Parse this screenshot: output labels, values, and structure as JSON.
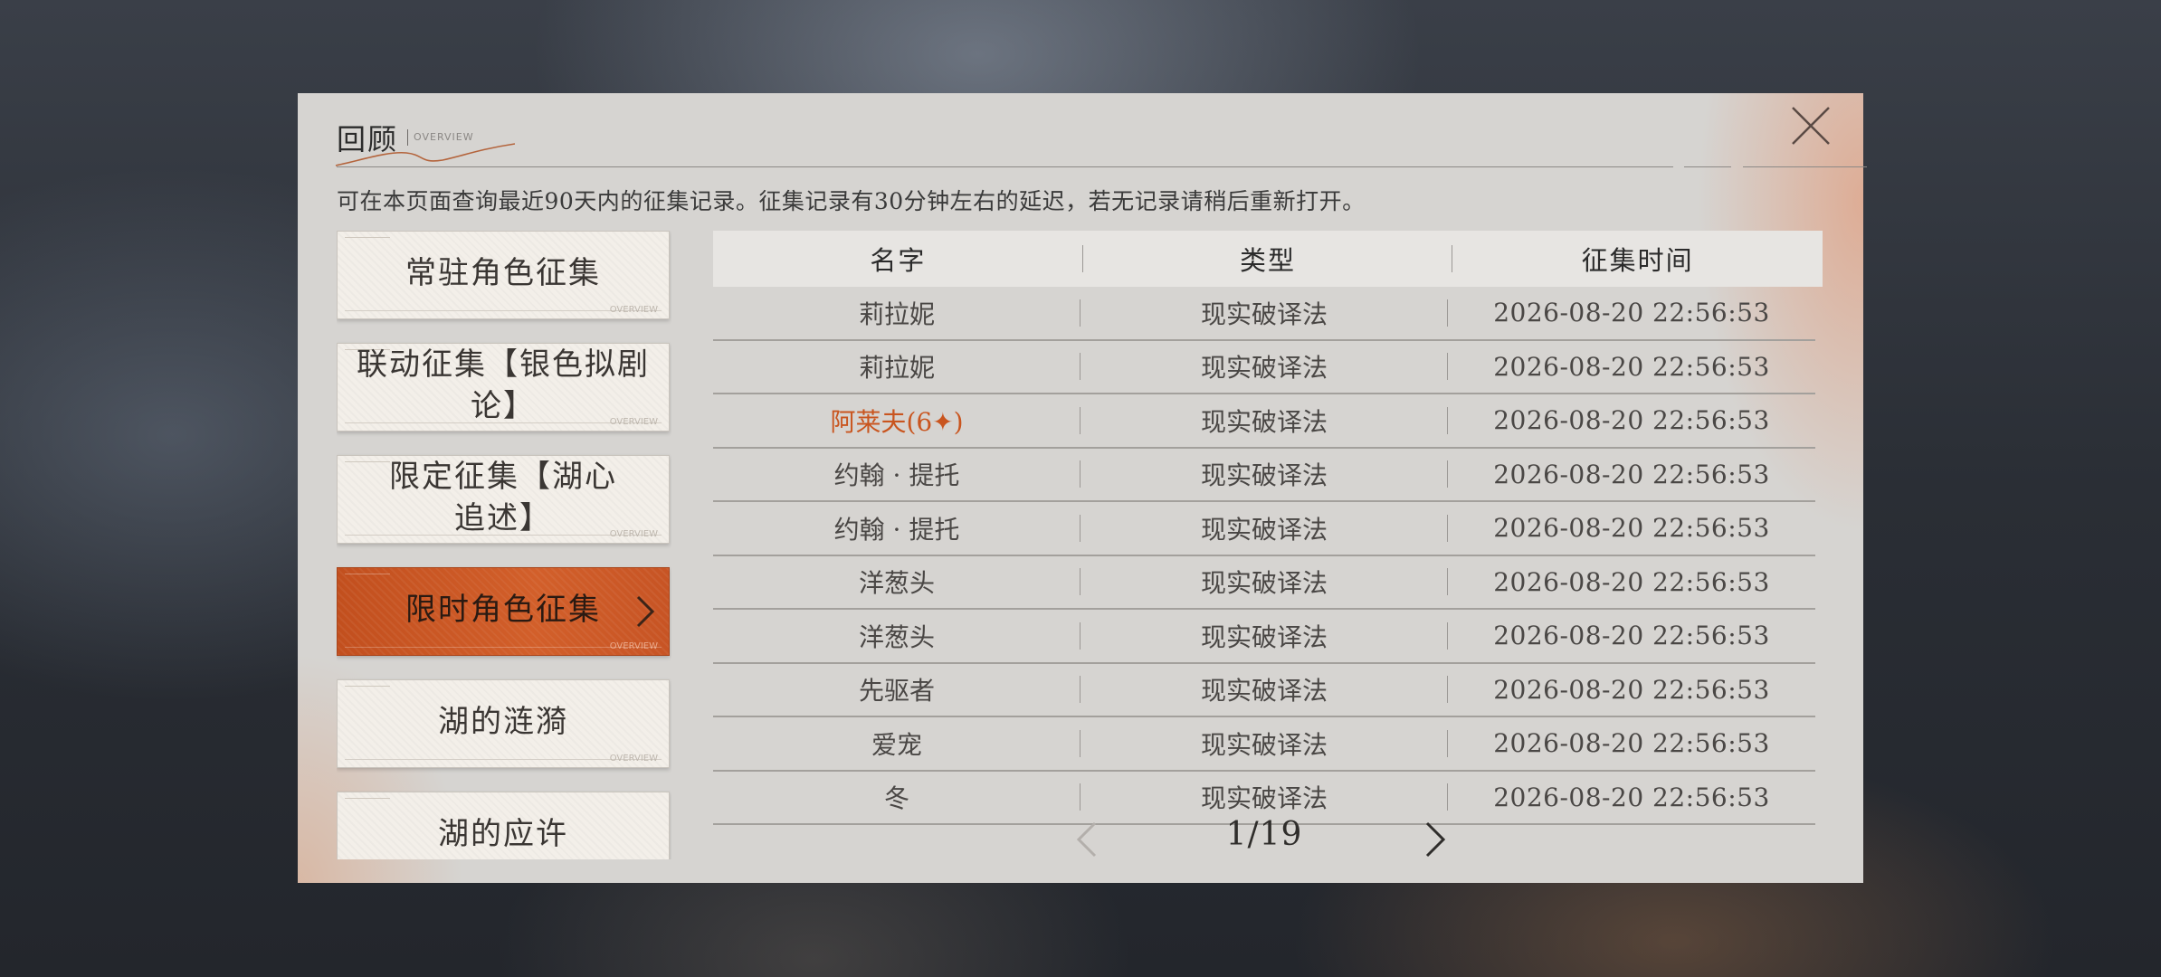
{
  "dialog": {
    "title": "回顾",
    "title_sub": "OVERVIEW",
    "description": "可在本页面查询最近90天内的征集记录。征集记录有30分钟左右的延迟，若无记录请稍后重新打开。"
  },
  "banners": [
    {
      "label": "常驻角色征集",
      "foot": "OVERVIEW",
      "active": false
    },
    {
      "label": "联动征集【银色拟剧论】",
      "foot": "OVERVIEW",
      "active": false
    },
    {
      "label": "限定征集【湖心追述】",
      "foot": "OVERVIEW",
      "active": false
    },
    {
      "label": "限时角色征集",
      "foot": "OVERVIEW",
      "active": true
    },
    {
      "label": "湖的涟漪",
      "foot": "OVERVIEW",
      "active": false
    },
    {
      "label": "湖的应许",
      "foot": "",
      "active": false
    }
  ],
  "table": {
    "headers": [
      "名字",
      "类型",
      "征集时间"
    ],
    "rows": [
      {
        "name": "莉拉妮",
        "type": "现实破译法",
        "time": "2026-08-20 22:56:53",
        "highlight": false
      },
      {
        "name": "莉拉妮",
        "type": "现实破译法",
        "time": "2026-08-20 22:56:53",
        "highlight": false
      },
      {
        "name": "阿莱夫(6✦)",
        "type": "现实破译法",
        "time": "2026-08-20 22:56:53",
        "highlight": true
      },
      {
        "name": "约翰 · 提托",
        "type": "现实破译法",
        "time": "2026-08-20 22:56:53",
        "highlight": false
      },
      {
        "name": "约翰 · 提托",
        "type": "现实破译法",
        "time": "2026-08-20 22:56:53",
        "highlight": false
      },
      {
        "name": "洋葱头",
        "type": "现实破译法",
        "time": "2026-08-20 22:56:53",
        "highlight": false
      },
      {
        "name": "洋葱头",
        "type": "现实破译法",
        "time": "2026-08-20 22:56:53",
        "highlight": false
      },
      {
        "name": "先驱者",
        "type": "现实破译法",
        "time": "2026-08-20 22:56:53",
        "highlight": false
      },
      {
        "name": "爱宠",
        "type": "现实破译法",
        "time": "2026-08-20 22:56:53",
        "highlight": false
      },
      {
        "name": "冬",
        "type": "现实破译法",
        "time": "2026-08-20 22:56:53",
        "highlight": false
      }
    ]
  },
  "pager": {
    "text": "1/19",
    "current": 1,
    "total": 19
  },
  "icons": {
    "close": "close-icon",
    "active_arrow": "chevron-right-icon",
    "prev": "chevron-left-icon",
    "next": "chevron-right-icon"
  },
  "colors": {
    "accent": "#c9551f",
    "dialog_bg": "#d6d4d1"
  }
}
